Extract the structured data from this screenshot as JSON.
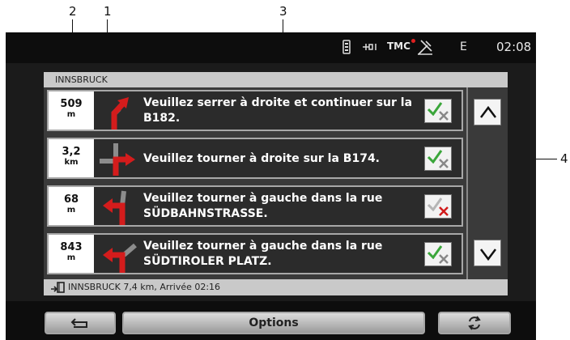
{
  "callouts": [
    "2",
    "1",
    "3",
    "4"
  ],
  "status": {
    "tmc_label": "TMC",
    "gps_letter": "E",
    "time": "02:08",
    "icons": [
      "phone-battery-icon",
      "bluetooth-icon",
      "tmc-icon",
      "gps-satellite-icon"
    ]
  },
  "destination": "INNSBRUCK",
  "maneuvers": [
    {
      "distance": "509",
      "unit": "m",
      "instruction": "Veuillez serrer à droite et continuer sur la B182.",
      "icon": "keep-right-arrow-icon",
      "avoid": false
    },
    {
      "distance": "3,2",
      "unit": "km",
      "instruction": "Veuillez tourner à droite sur la B174.",
      "icon": "turn-right-arrow-icon",
      "avoid": false
    },
    {
      "distance": "68",
      "unit": "m",
      "instruction": "Veuillez tourner à gauche dans la rue SÜDBAHNSTRASSE.",
      "icon": "turn-left-arrow-icon",
      "avoid": true
    },
    {
      "distance": "843",
      "unit": "m",
      "instruction": "Veuillez tourner à gauche dans la rue SÜDTIROLER PLATZ.",
      "icon": "turn-left-arrow-icon",
      "avoid": false
    }
  ],
  "info_bar": "INNSBRUCK 7,4 km, Arrivée 02:16",
  "bottom": {
    "back_icon": "back-arrow-icon",
    "options_label": "Options",
    "refresh_icon": "recalculate-icon"
  },
  "colors": {
    "check_green": "#3aa63a",
    "cross_red": "#d11a1a",
    "arrow_red": "#d41c1c",
    "road_grey": "#8c8c8c"
  }
}
